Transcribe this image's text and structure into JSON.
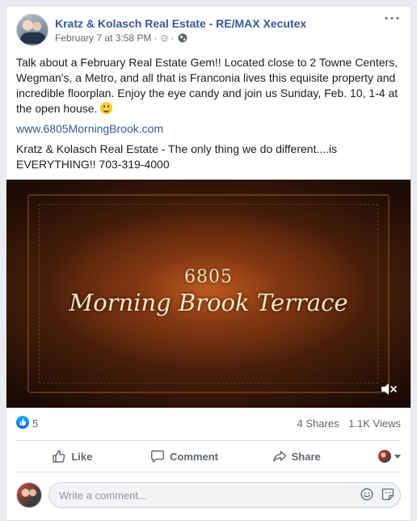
{
  "post": {
    "page_name": "Kratz & Kolasch Real Estate - RE/MAX Xecutex",
    "timestamp": "February 7 at 3:58 PM",
    "meta_separator": "·",
    "body_paragraph_1": "Talk about a February Real Estate Gem!! Located close to 2 Towne Centers, Wegman's, a Metro, and all that is Franconia lives this equisite property and incredible floorplan. Enjoy the eye candy and join us Sunday, Feb. 10, 1-4 at the open house.",
    "link": "www.6805MorningBrook.com",
    "body_paragraph_2": "Kratz & Kolasch Real Estate - The only thing we do different....is EVERYTHING!! 703-319-4000"
  },
  "video": {
    "number_text": "6805",
    "title_text": "Morning Brook Terrace",
    "muted": true
  },
  "reactions": {
    "like_count": "5",
    "shares": "4 Shares",
    "views": "1.1K Views"
  },
  "actions": {
    "like_label": "Like",
    "comment_label": "Comment",
    "share_label": "Share"
  },
  "composer": {
    "placeholder": "Write a comment..."
  },
  "icons": {
    "more": "more-options-icon",
    "privacy": "globe-icon",
    "mute": "speaker-muted-icon",
    "like_badge": "thumbs-up-icon",
    "emoji": "emoji-icon",
    "sticker": "sticker-icon"
  },
  "colors": {
    "link": "#385898",
    "like_blue": "#1877f2",
    "meta_gray": "#616770"
  }
}
